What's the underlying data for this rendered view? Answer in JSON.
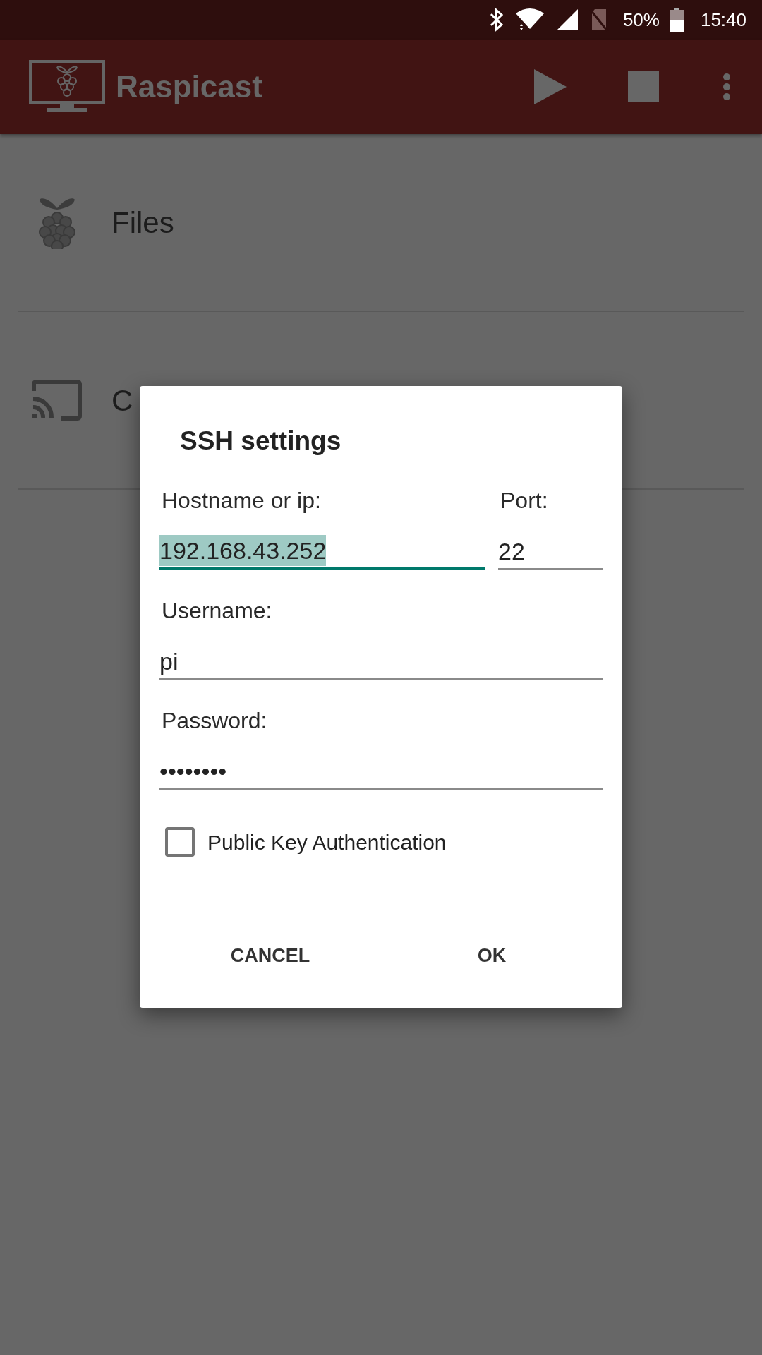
{
  "status_bar": {
    "battery": "50%",
    "time": "15:40"
  },
  "app_bar": {
    "title": "Raspicast"
  },
  "list": [
    {
      "kind": "files",
      "label": "Files"
    },
    {
      "kind": "cast",
      "label": "C"
    }
  ],
  "dialog": {
    "title": "SSH settings",
    "host": {
      "label": "Hostname or ip:",
      "value": "192.168.43.252",
      "focused": true,
      "selected": true
    },
    "port": {
      "label": "Port:",
      "value": "22",
      "focused": false
    },
    "username": {
      "label": "Username:",
      "value": "pi",
      "focused": false
    },
    "password": {
      "label": "Password:",
      "value": "••••••••",
      "focused": false
    },
    "public_key": {
      "label": "Public Key Authentication",
      "checked": false
    },
    "buttons": [
      "CANCEL",
      "OK"
    ]
  }
}
